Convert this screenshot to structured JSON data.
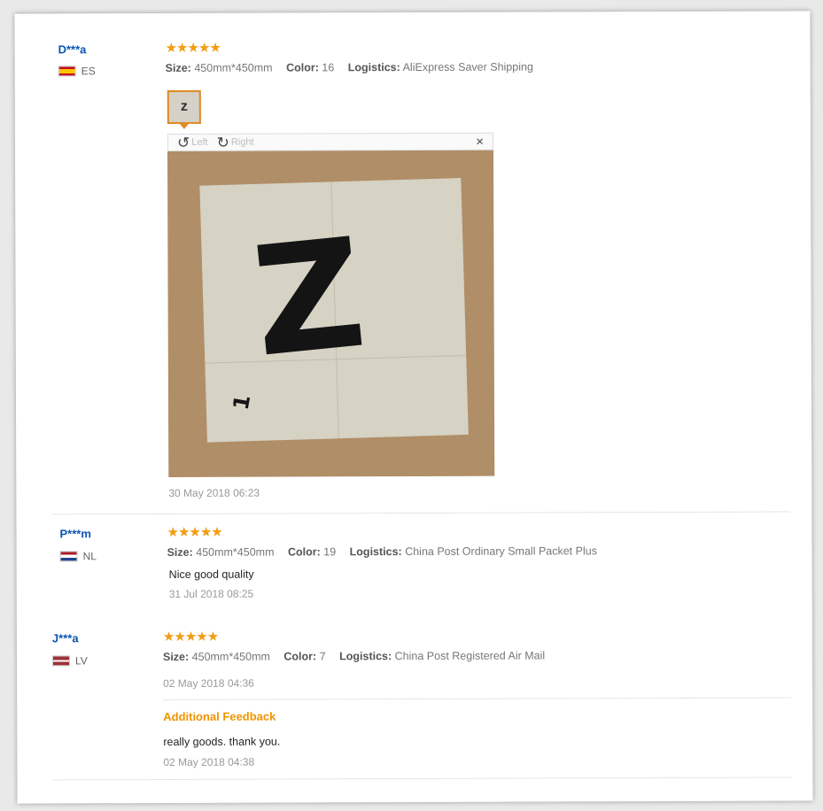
{
  "reviews": [
    {
      "user": "D***a",
      "country": "ES",
      "stars": "★★★★★",
      "size_label": "Size:",
      "size": "450mm*450mm",
      "color_label": "Color:",
      "color": "16",
      "logistics_label": "Logistics:",
      "logistics": "AliExpress Saver Shipping",
      "thumb_letter": "z",
      "viewer": {
        "left": "Left",
        "right": "Right",
        "close": "×",
        "photo_letter": "Z",
        "photo_small": "1"
      },
      "date": "30 May 2018 06:23"
    },
    {
      "user": "P***m",
      "country": "NL",
      "stars": "★★★★★",
      "size_label": "Size:",
      "size": "450mm*450mm",
      "color_label": "Color:",
      "color": "19",
      "logistics_label": "Logistics:",
      "logistics": "China Post Ordinary Small Packet Plus",
      "text": "Nice good quality",
      "date": "31 Jul 2018 08:25"
    },
    {
      "user": "J***a",
      "country": "LV",
      "stars": "★★★★★",
      "size_label": "Size:",
      "size": "450mm*450mm",
      "color_label": "Color:",
      "color": "7",
      "logistics_label": "Logistics:",
      "logistics": "China Post Registered Air Mail",
      "date": "02 May 2018 04:36",
      "additional_title": "Additional Feedback",
      "additional_text": "really goods. thank you.",
      "additional_date": "02 May 2018 04:38"
    }
  ],
  "colors": {
    "star": "#f39c12",
    "user": "#0b56b3",
    "additional": "#f29400",
    "thumb_border": "#e08a24"
  }
}
